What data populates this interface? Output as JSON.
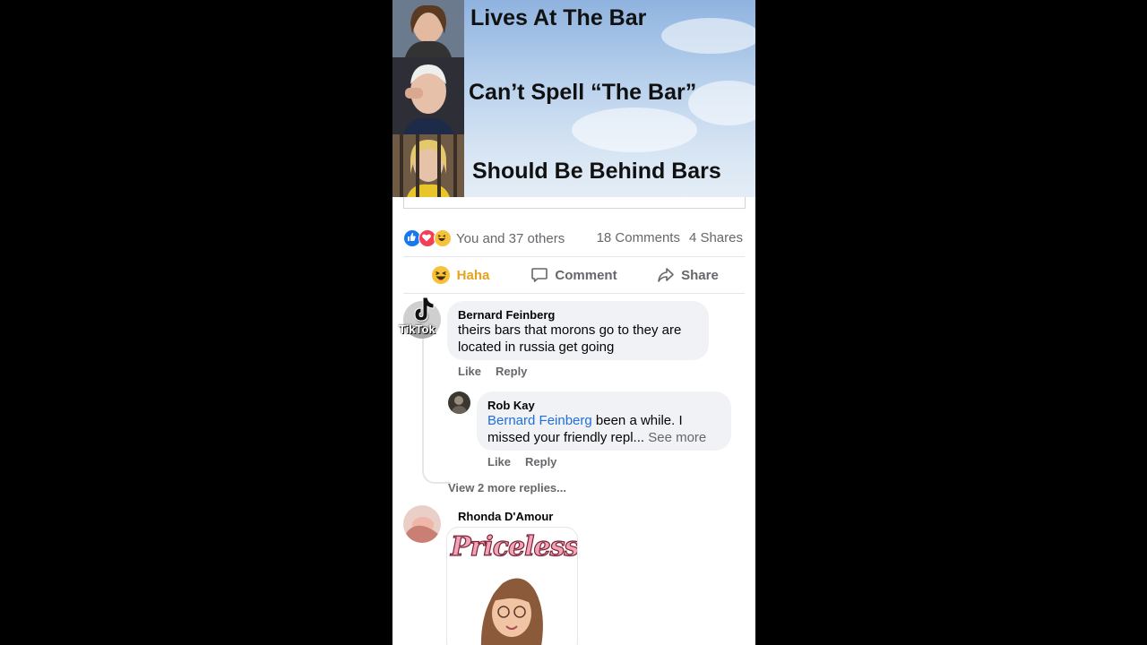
{
  "meme": {
    "lines": [
      "Lives At The Bar",
      "Can’t Spell “The Bar”",
      "Should Be Behind Bars"
    ]
  },
  "reactions": {
    "icons": [
      "like-icon",
      "love-icon",
      "haha-icon"
    ],
    "summary": "You and 37 others",
    "comments_count": "18 Comments",
    "shares_count": "4 Shares"
  },
  "actions": {
    "haha": "Haha",
    "comment": "Comment",
    "share": "Share"
  },
  "watermark": "TikTok",
  "comments": [
    {
      "author": "Bernard Feinberg",
      "text": "theirs bars that morons go to they are located in russia get going",
      "like": "Like",
      "reply": "Reply"
    },
    {
      "author": "Rob Kay",
      "mention": "Bernard Feinberg",
      "text_a": " been a while.  I",
      "text_b": "missed your friendly repl... ",
      "see_more": "See more",
      "like": "Like",
      "reply": "Reply"
    },
    {
      "author": "Rhonda D'Amour",
      "sticker_text": "Priceless"
    }
  ],
  "view_more": "View 2 more replies...",
  "colors": {
    "haha": "#e8a21b",
    "link": "#216fdb",
    "muted": "#65676b",
    "like_blue": "#1877f2",
    "love_red": "#f33e58"
  }
}
